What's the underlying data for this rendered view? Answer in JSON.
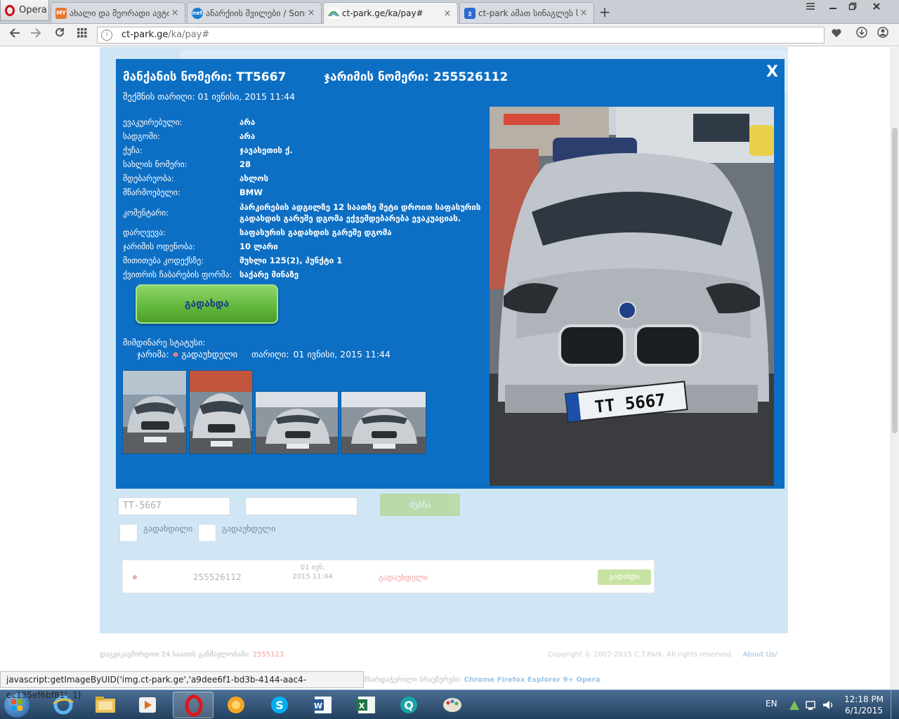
{
  "browser": {
    "menu_label": "Opera",
    "tabs": [
      {
        "label": "ახალი და მეორადი ავტომ",
        "icon_text": "MY",
        "color": "#e8772e",
        "active": false
      },
      {
        "label": "ანარქიის შვილები / Sons",
        "icon_text": "net",
        "color": "#1b7ccf",
        "active": false
      },
      {
        "label": "ct-park.ge/ka/pay#",
        "icon_text": "",
        "color": "#ffffff",
        "active": true
      },
      {
        "label": "ct-park ამათ სინაგლეს ს.",
        "icon_text": "ვ",
        "color": "#2c6bd0",
        "active": false
      }
    ],
    "tab_close": "×",
    "newtab": "+",
    "url_host": "ct-park.ge",
    "url_path": "/ka/pay#",
    "status_text": "javascript:getImageByUID('img.ct-park.ge','a9dee6f1-bd3b-4144-aac4-ec135ef6bf81', 1)"
  },
  "modal": {
    "car_number": "მანქანის ნომერი: TT5667",
    "fine_number": "ჯარიმის ნომერი: 255526112",
    "created": "შექმნის თარიღი: 01 ივნისი, 2015 11:44",
    "close": "X",
    "details": [
      {
        "label": "ევაკუირებული:",
        "value": "არა"
      },
      {
        "label": "სადგომი:",
        "value": "არა"
      },
      {
        "label": "ქუჩა:",
        "value": "ჯავახეთის ქ."
      },
      {
        "label": "სახლის ნომერი:",
        "value": "28"
      },
      {
        "label": "მდებარეობა:",
        "value": "ახლოს"
      },
      {
        "label": "მწარმოებელი:",
        "value": "BMW"
      },
      {
        "label": "კომენტარი:",
        "value": "პარკირების ადგილზე 12 საათზე მეტი დროით საფასურის გადახდის გარეშე დგომა ექვემდებარება ევაკუაციას."
      },
      {
        "label": "დარღვევა:",
        "value": "საფასურის გადახდის გარეშე დგომა"
      },
      {
        "label": "ჯარიმის ოდენობა:",
        "value": "10 ლარი"
      },
      {
        "label": "მითითება კოდექსზე:",
        "value": "მუხლი 125(2), პუნქტი 1"
      },
      {
        "label": "ქვითრის ჩაბარების ფორმა:",
        "value": "საქარე მინაზე"
      }
    ],
    "pay_button": "გადახდა",
    "status_title": "მიმდინარე სტატუსი:",
    "status_fine_label": "ჯარიმა:",
    "status_value": "გადაუხდელი",
    "status_date_label": "თარიღი:",
    "status_date": "01 ივნისი, 2015 11:44",
    "plate_text": "TT 5667"
  },
  "background": {
    "search_plate": "TT-5667",
    "search_button": "ძებნა",
    "filter_paid": "გადახდილი",
    "filter_unpaid": "გადაუხდელი",
    "row_number": "255526112",
    "row_date": "01 ივნ, 2015 11:44",
    "row_status": "გადაუხდელი",
    "row_pay": "გადახდა",
    "footer_left": "დაგვიკავშირდით 24 საათის განმავლობაში:",
    "footer_phone": "2555123",
    "copyright": "Copyright © 2007-2015 C.T.Park. All rights reserved.",
    "about": "About Us/",
    "browsers_label": "მხარდაჭერილი ბრაუზერები:",
    "browsers_list": "Chrome Firefox Explorer 9+ Opera"
  },
  "taskbar": {
    "lang": "EN",
    "time": "12:18 PM",
    "date": "6/1/2015",
    "apps": [
      "ie-icon",
      "explorer-icon",
      "media-player-icon",
      "opera-icon",
      "chrome-like-icon",
      "skype-icon",
      "word-icon",
      "excel-icon",
      "q-app-icon",
      "paint-icon"
    ]
  }
}
